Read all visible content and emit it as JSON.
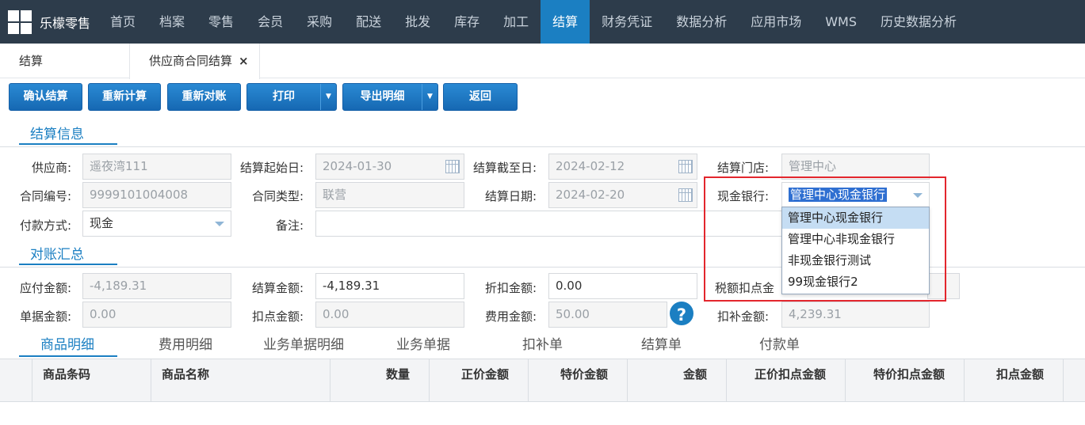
{
  "nav": {
    "brand": "乐檬零售",
    "items": [
      "首页",
      "档案",
      "零售",
      "会员",
      "采购",
      "配送",
      "批发",
      "库存",
      "加工",
      "结算",
      "财务凭证",
      "数据分析",
      "应用市场",
      "WMS",
      "历史数据分析"
    ],
    "active": "结算"
  },
  "tabs": {
    "tab1": "结算",
    "tab2": "供应商合同结算",
    "close": "×"
  },
  "toolbar": {
    "confirm": "确认结算",
    "recalc": "重新计算",
    "reconcile": "重新对账",
    "print": "打印",
    "export": "导出明细",
    "back": "返回",
    "caret": "▼"
  },
  "sections": {
    "settle_info": "结算信息",
    "reconcile_summary": "对账汇总"
  },
  "form": {
    "supplier_label": "供应商:",
    "supplier": "遥夜湾111",
    "start_label": "结算起始日:",
    "start": "2024-01-30",
    "end_label": "结算截至日:",
    "end": "2024-02-12",
    "store_label": "结算门店:",
    "store": "管理中心",
    "contract_no_label": "合同编号:",
    "contract_no": "9999101004008",
    "contract_type_label": "合同类型:",
    "contract_type": "联营",
    "settle_date_label": "结算日期:",
    "settle_date": "2024-02-20",
    "bank_label": "现金银行:",
    "bank": "管理中心现金银行",
    "pay_label": "付款方式:",
    "pay": "现金",
    "remark_label": "备注:",
    "remark": ""
  },
  "bank_dropdown": [
    "管理中心现金银行",
    "管理中心非现金银行",
    "非现金银行测试",
    "99现金银行2"
  ],
  "summary": {
    "payable_label": "应付金额:",
    "payable": "-4,189.31",
    "settle_amt_label": "结算金额:",
    "settle_amt": "-4,189.31",
    "discount_label": "折扣金额:",
    "discount": "0.00",
    "tax_label": "税额扣点金",
    "doc_amt_label": "单据金额:",
    "doc_amt": "0.00",
    "deduct_label": "扣点金额:",
    "deduct": "0.00",
    "fee_label": "费用金额:",
    "fee": "50.00",
    "help": "?",
    "supplement_label": "扣补金额:",
    "supplement": "4,239.31"
  },
  "detail_tabs": [
    "商品明细",
    "费用明细",
    "业务单据明细",
    "业务单据",
    "扣补单",
    "结算单",
    "付款单"
  ],
  "grid_columns": [
    "商品条码",
    "商品名称",
    "数量",
    "正价金额",
    "特价金额",
    "金额",
    "正价扣点金额",
    "特价扣点金额",
    "扣点金额"
  ]
}
